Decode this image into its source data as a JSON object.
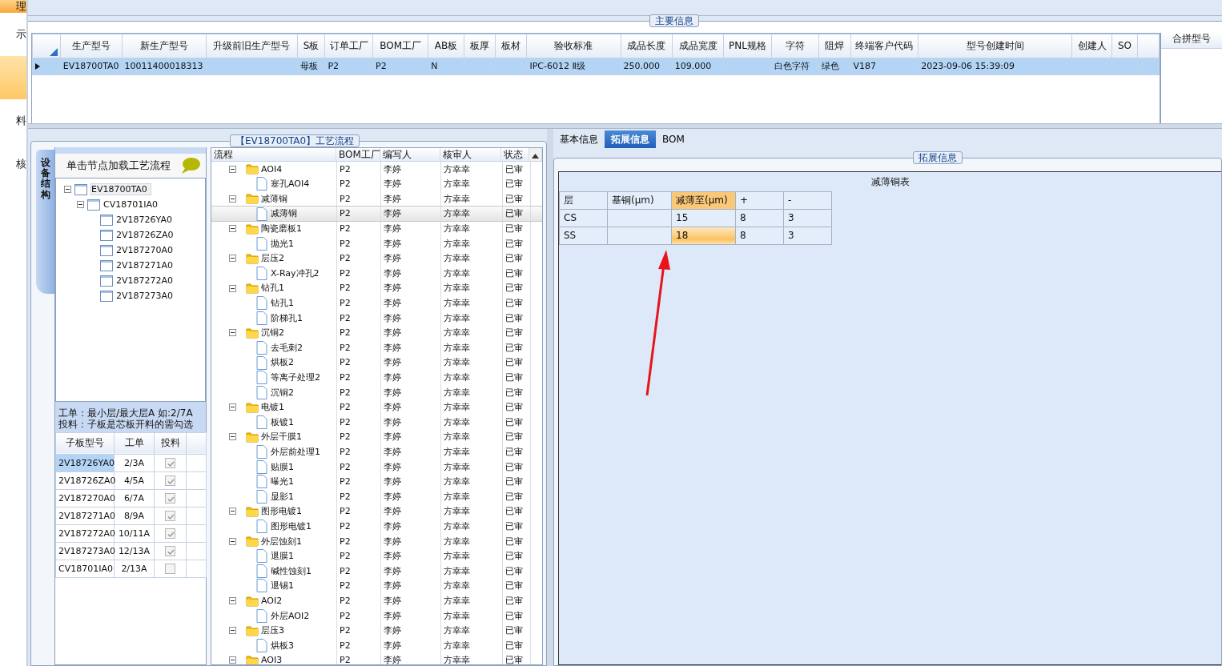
{
  "sidebar": {
    "items": [
      {
        "kind": "header",
        "text": "理"
      },
      {
        "kind": "item",
        "text": "示",
        "selected": false
      },
      {
        "kind": "item",
        "selected": true
      },
      {
        "kind": "item",
        "text": "料",
        "selected": false
      },
      {
        "kind": "item",
        "text": "核",
        "selected": false
      }
    ]
  },
  "main_info": {
    "title": "主要信息",
    "columns": [
      "生产型号",
      "新生产型号",
      "升级前旧生产型号",
      "S板",
      "订单工厂",
      "BOM工厂",
      "AB板",
      "板厚",
      "板材",
      "验收标准",
      "成品长度",
      "成品宽度",
      "PNL规格",
      "字符",
      "阻焊",
      "终端客户代码",
      "型号创建时间",
      "创建人",
      "SO"
    ],
    "rows": [
      {
        "selected": true,
        "cells": [
          "EV18700TA0",
          "10011400018313",
          null,
          "母板",
          "P2",
          "P2",
          "N",
          null,
          null,
          "IPC-6012 Ⅱ级",
          "250.000",
          "109.000",
          null,
          "白色字符",
          "绿色",
          "V187",
          "2023-09-06 15:39:09",
          null,
          null
        ]
      }
    ]
  },
  "merge_panel": {
    "title": "合拼型号"
  },
  "process_panel": {
    "title": "【EV18700TA0】工艺流程",
    "side_tab": "设备结构",
    "tree_header": "单击节点加载工艺流程",
    "structure_tree": [
      {
        "label": "EV18700TA0",
        "selected": true,
        "expanded": true,
        "children": [
          {
            "label": "CV18701IA0",
            "selected": false,
            "expanded": true,
            "children": [
              {
                "label": "2V18726YA0",
                "selected": false
              },
              {
                "label": "2V18726ZA0",
                "selected": false
              },
              {
                "label": "2V187270A0",
                "selected": false
              },
              {
                "label": "2V187271A0",
                "selected": false
              },
              {
                "label": "2V187272A0",
                "selected": false
              },
              {
                "label": "2V187273A0",
                "selected": false
              }
            ]
          }
        ]
      }
    ],
    "hint": [
      "工单：最小层/最大层A 如:2/7A",
      "投料：子板是芯板开料的需勾选"
    ],
    "sub_grid": {
      "columns": [
        "子板型号",
        "工单",
        "投料"
      ],
      "rows": [
        {
          "model": "2V18726YA0",
          "order": "2/3A",
          "checked": true,
          "selected": true
        },
        {
          "model": "2V18726ZA0",
          "order": "4/5A",
          "checked": true,
          "selected": false
        },
        {
          "model": "2V187270A0",
          "order": "6/7A",
          "checked": true,
          "selected": false
        },
        {
          "model": "2V187271A0",
          "order": "8/9A",
          "checked": true,
          "selected": false
        },
        {
          "model": "2V187272A0",
          "order": "10/11A",
          "checked": true,
          "selected": false
        },
        {
          "model": "2V187273A0",
          "order": "12/13A",
          "checked": true,
          "selected": false
        },
        {
          "model": "CV18701IA0",
          "order": "2/13A",
          "checked": false,
          "selected": false
        }
      ]
    },
    "flow_grid": {
      "columns": [
        "流程",
        "BOM工厂",
        "编写人",
        "核审人",
        "状态"
      ],
      "rows": [
        {
          "name": "AOI4",
          "bom": "P2",
          "writer": "李婷",
          "reviewer": "方幸幸",
          "status": "已审",
          "selected": false,
          "expanded": true,
          "children": [
            {
              "name": "塞孔AOI4",
              "bom": "P2",
              "writer": "李婷",
              "reviewer": "方幸幸",
              "status": "已审",
              "selected": false
            }
          ]
        },
        {
          "name": "减薄铜",
          "bom": "P2",
          "writer": "李婷",
          "reviewer": "方幸幸",
          "status": "已审",
          "selected": false,
          "expanded": true,
          "children": [
            {
              "name": "减薄铜",
              "bom": "P2",
              "writer": "李婷",
              "reviewer": "方幸幸",
              "status": "已审",
              "selected": true
            }
          ]
        },
        {
          "name": "陶瓷磨板1",
          "bom": "P2",
          "writer": "李婷",
          "reviewer": "方幸幸",
          "status": "已审",
          "selected": false,
          "expanded": true,
          "children": [
            {
              "name": "抛光1",
              "bom": "P2",
              "writer": "李婷",
              "reviewer": "方幸幸",
              "status": "已审",
              "selected": false
            }
          ]
        },
        {
          "name": "层压2",
          "bom": "P2",
          "writer": "李婷",
          "reviewer": "方幸幸",
          "status": "已审",
          "selected": false,
          "expanded": true,
          "children": [
            {
              "name": "X-Ray冲孔2",
              "bom": "P2",
              "writer": "李婷",
              "reviewer": "方幸幸",
              "status": "已审",
              "selected": false
            }
          ]
        },
        {
          "name": "钻孔1",
          "bom": "P2",
          "writer": "李婷",
          "reviewer": "方幸幸",
          "status": "已审",
          "selected": false,
          "expanded": true,
          "children": [
            {
              "name": "钻孔1",
              "bom": "P2",
              "writer": "李婷",
              "reviewer": "方幸幸",
              "status": "已审",
              "selected": false
            },
            {
              "name": "阶梯孔1",
              "bom": "P2",
              "writer": "李婷",
              "reviewer": "方幸幸",
              "status": "已审",
              "selected": false
            }
          ]
        },
        {
          "name": "沉铜2",
          "bom": "P2",
          "writer": "李婷",
          "reviewer": "方幸幸",
          "status": "已审",
          "selected": false,
          "expanded": true,
          "children": [
            {
              "name": "去毛刺2",
              "bom": "P2",
              "writer": "李婷",
              "reviewer": "方幸幸",
              "status": "已审",
              "selected": false
            },
            {
              "name": "烘板2",
              "bom": "P2",
              "writer": "李婷",
              "reviewer": "方幸幸",
              "status": "已审",
              "selected": false
            },
            {
              "name": "等离子处理2",
              "bom": "P2",
              "writer": "李婷",
              "reviewer": "方幸幸",
              "status": "已审",
              "selected": false
            },
            {
              "name": "沉铜2",
              "bom": "P2",
              "writer": "李婷",
              "reviewer": "方幸幸",
              "status": "已审",
              "selected": false
            }
          ]
        },
        {
          "name": "电镀1",
          "bom": "P2",
          "writer": "李婷",
          "reviewer": "方幸幸",
          "status": "已审",
          "selected": false,
          "expanded": true,
          "children": [
            {
              "name": "板镀1",
              "bom": "P2",
              "writer": "李婷",
              "reviewer": "方幸幸",
              "status": "已审",
              "selected": false
            }
          ]
        },
        {
          "name": "外层干膜1",
          "bom": "P2",
          "writer": "李婷",
          "reviewer": "方幸幸",
          "status": "已审",
          "selected": false,
          "expanded": true,
          "children": [
            {
              "name": "外层前处理1",
              "bom": "P2",
              "writer": "李婷",
              "reviewer": "方幸幸",
              "status": "已审",
              "selected": false
            },
            {
              "name": "贴膜1",
              "bom": "P2",
              "writer": "李婷",
              "reviewer": "方幸幸",
              "status": "已审",
              "selected": false
            },
            {
              "name": "曝光1",
              "bom": "P2",
              "writer": "李婷",
              "reviewer": "方幸幸",
              "status": "已审",
              "selected": false
            },
            {
              "name": "显影1",
              "bom": "P2",
              "writer": "李婷",
              "reviewer": "方幸幸",
              "status": "已审",
              "selected": false
            }
          ]
        },
        {
          "name": "图形电镀1",
          "bom": "P2",
          "writer": "李婷",
          "reviewer": "方幸幸",
          "status": "已审",
          "selected": false,
          "expanded": true,
          "children": [
            {
              "name": "图形电镀1",
              "bom": "P2",
              "writer": "李婷",
              "reviewer": "方幸幸",
              "status": "已审",
              "selected": false
            }
          ]
        },
        {
          "name": "外层蚀刻1",
          "bom": "P2",
          "writer": "李婷",
          "reviewer": "方幸幸",
          "status": "已审",
          "selected": false,
          "expanded": true,
          "children": [
            {
              "name": "退膜1",
              "bom": "P2",
              "writer": "李婷",
              "reviewer": "方幸幸",
              "status": "已审",
              "selected": false
            },
            {
              "name": "碱性蚀刻1",
              "bom": "P2",
              "writer": "李婷",
              "reviewer": "方幸幸",
              "status": "已审",
              "selected": false
            },
            {
              "name": "退锡1",
              "bom": "P2",
              "writer": "李婷",
              "reviewer": "方幸幸",
              "status": "已审",
              "selected": false
            }
          ]
        },
        {
          "name": "AOI2",
          "bom": "P2",
          "writer": "李婷",
          "reviewer": "方幸幸",
          "status": "已审",
          "selected": false,
          "expanded": true,
          "children": [
            {
              "name": "外层AOI2",
              "bom": "P2",
              "writer": "李婷",
              "reviewer": "方幸幸",
              "status": "已审",
              "selected": false
            }
          ]
        },
        {
          "name": "层压3",
          "bom": "P2",
          "writer": "李婷",
          "reviewer": "方幸幸",
          "status": "已审",
          "selected": false,
          "expanded": true,
          "children": [
            {
              "name": "烘板3",
              "bom": "P2",
              "writer": "李婷",
              "reviewer": "方幸幸",
              "status": "已审",
              "selected": false
            }
          ]
        },
        {
          "name": "AOI3",
          "bom": "P2",
          "writer": "李婷",
          "reviewer": "方幸幸",
          "status": "已审",
          "selected": false,
          "expanded": true
        }
      ]
    }
  },
  "detail_panel": {
    "tabs": [
      {
        "label": "基本信息",
        "selected": false
      },
      {
        "label": "拓展信息",
        "selected": true
      },
      {
        "label": "BOM",
        "selected": false
      }
    ],
    "group_title": "拓展信息",
    "table_title": "减薄铜表",
    "columns": [
      {
        "label": "层",
        "selected": false
      },
      {
        "label": "基铜(μm)",
        "selected": false
      },
      {
        "label": "减薄至(μm)",
        "selected": true
      },
      {
        "label": "+",
        "selected": false
      },
      {
        "label": "-",
        "selected": false
      }
    ],
    "rows": [
      {
        "selected": false,
        "cells": [
          "CS",
          null,
          "15",
          "8",
          "3"
        ]
      },
      {
        "selected": true,
        "cells": [
          "SS",
          null,
          "18",
          "8",
          "3"
        ]
      }
    ]
  }
}
